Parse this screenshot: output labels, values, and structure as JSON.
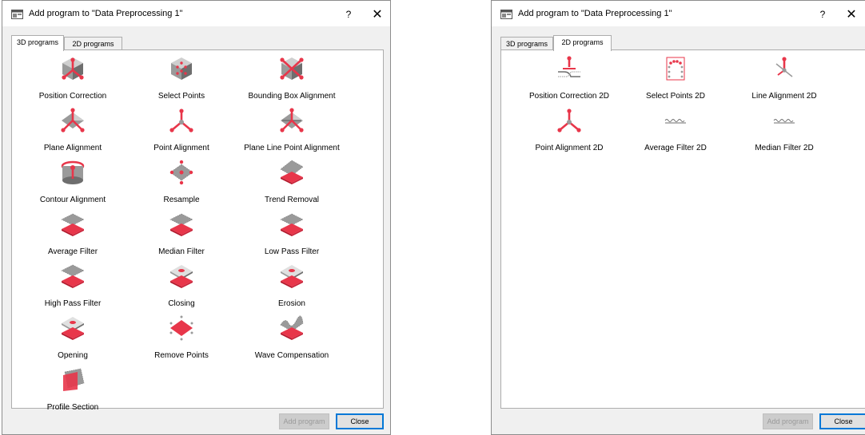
{
  "dialog": {
    "title": "Add program to \"Data Preprocessing 1\"",
    "help": "?",
    "close": "✕",
    "tabs": [
      "3D programs",
      "2D programs"
    ],
    "buttons": {
      "add": "Add program",
      "close": "Close"
    }
  },
  "programs_3d": [
    {
      "label": "Position Correction",
      "icon": "position-correction-icon"
    },
    {
      "label": "Select Points",
      "icon": "select-points-icon"
    },
    {
      "label": "Bounding Box Alignment",
      "icon": "bounding-box-alignment-icon"
    },
    {
      "label": "Plane Alignment",
      "icon": "plane-alignment-icon"
    },
    {
      "label": "Point Alignment",
      "icon": "point-alignment-icon"
    },
    {
      "label": "Plane Line Point Alignment",
      "icon": "plane-line-point-alignment-icon"
    },
    {
      "label": "Contour Alignment",
      "icon": "contour-alignment-icon"
    },
    {
      "label": "Resample",
      "icon": "resample-icon"
    },
    {
      "label": "Trend Removal",
      "icon": "trend-removal-icon"
    },
    {
      "label": "Average Filter",
      "icon": "average-filter-icon"
    },
    {
      "label": "Median Filter",
      "icon": "median-filter-icon"
    },
    {
      "label": "Low Pass Filter",
      "icon": "low-pass-filter-icon"
    },
    {
      "label": "High Pass Filter",
      "icon": "high-pass-filter-icon"
    },
    {
      "label": "Closing",
      "icon": "closing-icon"
    },
    {
      "label": "Erosion",
      "icon": "erosion-icon"
    },
    {
      "label": "Opening",
      "icon": "opening-icon"
    },
    {
      "label": "Remove Points",
      "icon": "remove-points-icon"
    },
    {
      "label": "Wave Compensation",
      "icon": "wave-compensation-icon"
    },
    {
      "label": "Profile Section",
      "icon": "profile-section-icon"
    }
  ],
  "programs_2d": [
    {
      "label": "Position Correction 2D",
      "icon": "position-correction-2d-icon"
    },
    {
      "label": "Select Points 2D",
      "icon": "select-points-2d-icon"
    },
    {
      "label": "Line Alignment 2D",
      "icon": "line-alignment-2d-icon"
    },
    {
      "label": "Point Alignment 2D",
      "icon": "point-alignment-2d-icon"
    },
    {
      "label": "Average Filter 2D",
      "icon": "average-filter-2d-icon"
    },
    {
      "label": "Median Filter 2D",
      "icon": "median-filter-2d-icon"
    }
  ],
  "colors": {
    "accent_red": "#e8364a",
    "surface_gray": "#9a9a9a",
    "focus_blue": "#0078d7"
  }
}
